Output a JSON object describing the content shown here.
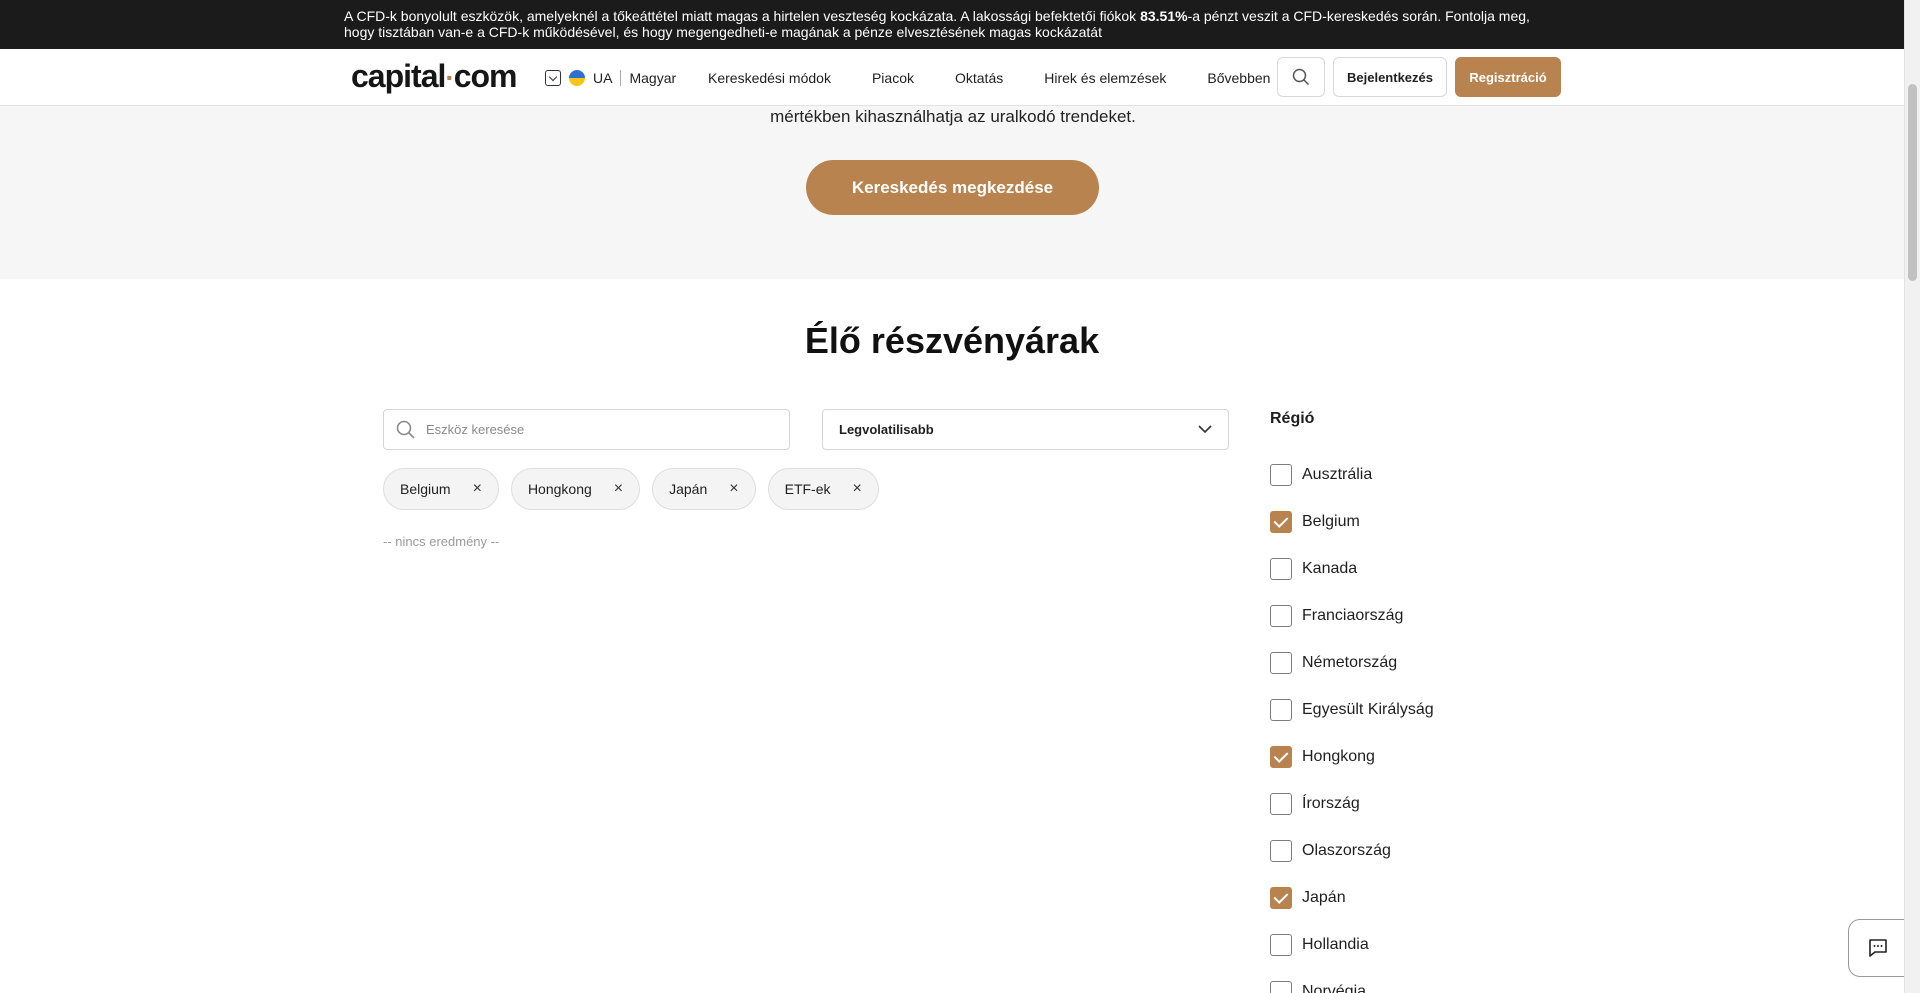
{
  "risk_banner": {
    "text_before": "A CFD-k bonyolult eszközök, amelyeknél a tőkeáttétel miatt magas a hirtelen veszteség kockázata. A lakossági befektetői fiókok ",
    "percent": "83.51%",
    "text_after": "-a pénzt veszit a CFD-kereskedés során. Fontolja meg, hogy tisztában van-e a CFD-k működésével, és hogy megengedheti-e magának a pénze elvesztésének magas kockázatát"
  },
  "header": {
    "logo_left": "capital",
    "logo_dot": "·",
    "logo_right": "com",
    "lang_code": "UA",
    "lang_name": "Magyar",
    "nav": [
      "Kereskedési módok",
      "Piacok",
      "Oktatás",
      "Hirek és elemzések",
      "Bővebben"
    ],
    "login": "Bejelentkezés",
    "register": "Regisztráció"
  },
  "hero": {
    "text": "mértékben kihasználhatja az uralkodó trendeket.",
    "cta": "Kereskedés megkezdése"
  },
  "section": {
    "title": "Élő részvényárak",
    "search_placeholder": "Eszköz keresése",
    "sort_value": "Legvolatilisabb",
    "chips": [
      "Belgium",
      "Hongkong",
      "Japán",
      "ETF-ek"
    ],
    "chip_remove": "×",
    "no_result": "-- nincs eredmény --"
  },
  "region": {
    "title": "Régió",
    "items": [
      {
        "label": "Ausztrália",
        "checked": false
      },
      {
        "label": "Belgium",
        "checked": true
      },
      {
        "label": "Kanada",
        "checked": false
      },
      {
        "label": "Franciaország",
        "checked": false
      },
      {
        "label": "Németország",
        "checked": false
      },
      {
        "label": "Egyesült Királyság",
        "checked": false
      },
      {
        "label": "Hongkong",
        "checked": true
      },
      {
        "label": "Írország",
        "checked": false
      },
      {
        "label": "Olaszország",
        "checked": false
      },
      {
        "label": "Japán",
        "checked": true
      },
      {
        "label": "Hollandia",
        "checked": false
      },
      {
        "label": "Norvégia",
        "checked": false
      }
    ]
  },
  "colors": {
    "accent": "#b9834f",
    "banner_bg": "#1b1b1b",
    "hero_bg": "#f6f6f6"
  }
}
